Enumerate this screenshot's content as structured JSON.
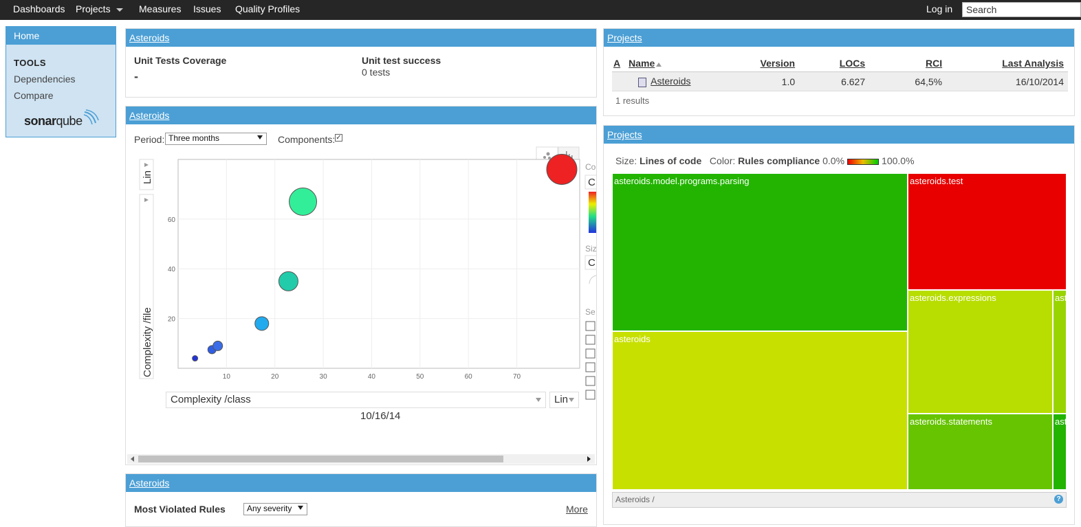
{
  "nav": {
    "items": [
      "Dashboards",
      "Projects",
      "Measures",
      "Issues",
      "Quality Profiles"
    ],
    "login": "Log in",
    "search_placeholder": "Search"
  },
  "sidebar": {
    "home": "Home",
    "tools_heading": "TOOLS",
    "links": [
      "Dependencies",
      "Compare"
    ],
    "logo_bold": "sonar",
    "logo_light": "qube"
  },
  "widget_tests": {
    "title": "Asteroids",
    "coverage_label": "Unit Tests Coverage",
    "coverage_value": "-",
    "success_label": "Unit test success",
    "success_value": "0 tests"
  },
  "widget_bubble": {
    "title": "Asteroids",
    "period_label": "Period:",
    "period_value": "Three months",
    "components_label": "Components:",
    "components_checked": true,
    "x_metric": "Complexity /class",
    "x_scale": "Lin",
    "y_metric": "Complexity /file",
    "y_scale": "Lin",
    "date": "10/16/14",
    "side_labels": [
      "Co",
      "C",
      "Siz",
      "C",
      "Se"
    ]
  },
  "chart_data": {
    "type": "scatter",
    "title": "",
    "xlabel": "Complexity /class",
    "ylabel": "Complexity /file",
    "x_ticks": [
      10,
      20,
      30,
      40,
      50,
      60,
      70
    ],
    "y_ticks": [
      20,
      40,
      60
    ],
    "xlim": [
      0,
      83
    ],
    "ylim": [
      0,
      84
    ],
    "grid": true,
    "points": [
      {
        "x": 3.5,
        "y": 4,
        "size": 4,
        "color": "#2233dd"
      },
      {
        "x": 7,
        "y": 7.5,
        "size": 6,
        "color": "#2f5ee6"
      },
      {
        "x": 8.2,
        "y": 9,
        "size": 7,
        "color": "#3b6de8"
      },
      {
        "x": 17.3,
        "y": 18,
        "size": 10,
        "color": "#22aaee"
      },
      {
        "x": 22.8,
        "y": 35,
        "size": 14,
        "color": "#22ccaa"
      },
      {
        "x": 25.8,
        "y": 67,
        "size": 20,
        "color": "#33ee99"
      },
      {
        "x": 79.3,
        "y": 80,
        "size": 22,
        "color": "#ee2222"
      }
    ]
  },
  "widget_violations": {
    "title": "Asteroids",
    "label": "Most Violated Rules",
    "severity": "Any severity",
    "more": "More"
  },
  "projects_table": {
    "title": "Projects",
    "headers": [
      "A",
      "Name",
      "Version",
      "LOCs",
      "RCI",
      "Last Analysis"
    ],
    "rows": [
      {
        "name": "Asteroids",
        "version": "1.0",
        "locs": "6.627",
        "rci": "64,5%",
        "last_analysis": "16/10/2014"
      }
    ],
    "results": "1 results"
  },
  "treemap": {
    "title": "Projects",
    "size_label": "Size:",
    "size_metric": "Lines of code",
    "color_label": "Color:",
    "color_metric": "Rules compliance",
    "min": "0.0%",
    "max": "100.0%",
    "tiles": [
      {
        "label": "asteroids.model.programs.parsing",
        "color": "#22b400"
      },
      {
        "label": "asteroids.test",
        "color": "#e80000"
      },
      {
        "label": "asteroids",
        "color": "#c8e000"
      },
      {
        "label": "asteroids.expressions",
        "color": "#b8dd00"
      },
      {
        "label": "asteroids.statements",
        "color": "#66c400"
      },
      {
        "label": "ast",
        "color": "#99d400"
      },
      {
        "label": "ast",
        "color": "#22b400"
      }
    ],
    "breadcrumb": "Asteroids /",
    "help": "?"
  }
}
